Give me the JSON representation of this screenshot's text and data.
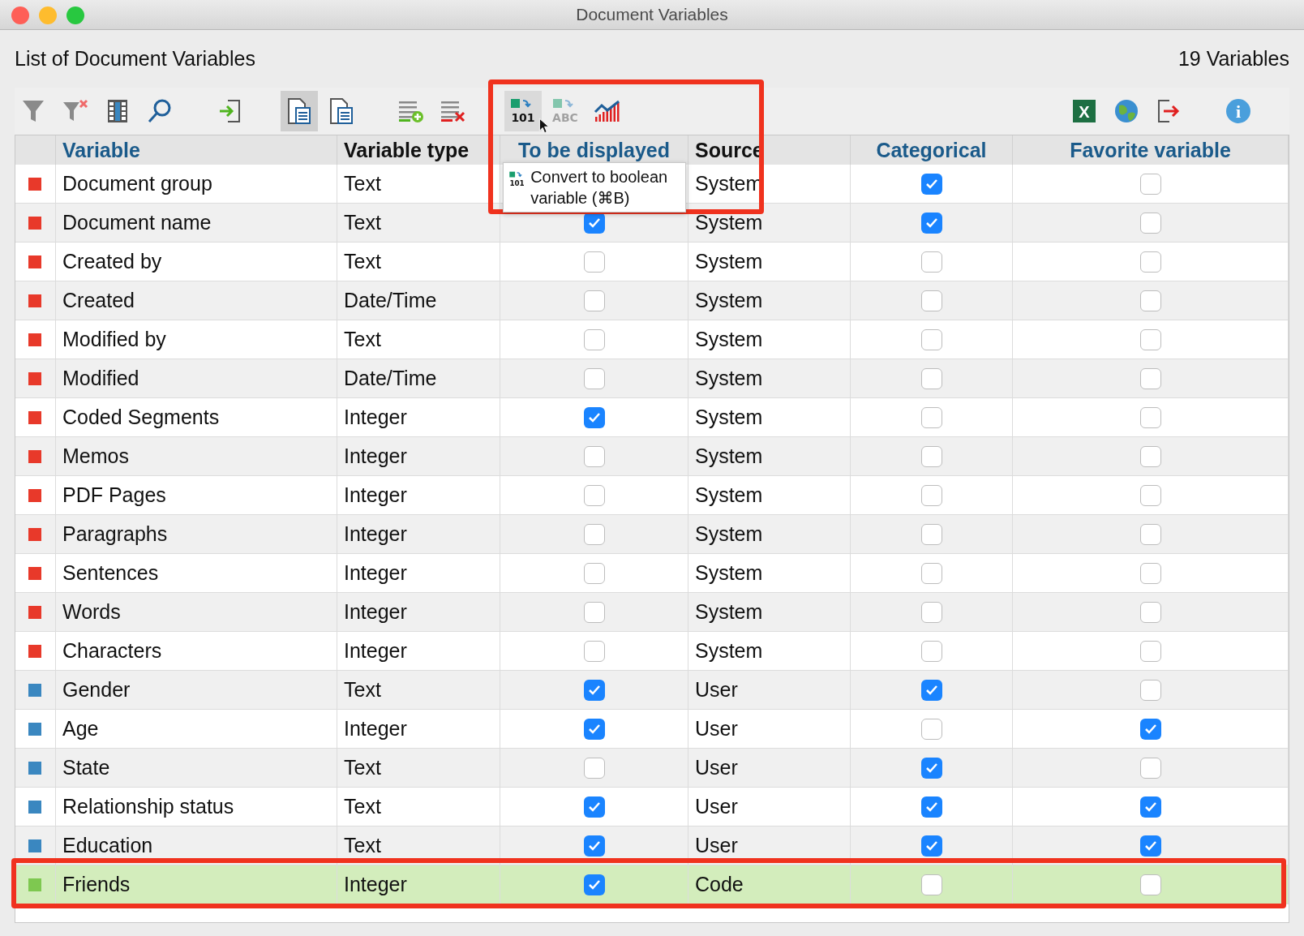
{
  "window": {
    "title": "Document Variables"
  },
  "heading": "List of Document Variables",
  "count": "19 Variables",
  "toolbar": {
    "groups": [
      [
        {
          "kind": "filter",
          "pressed": false
        },
        {
          "kind": "clear-filter",
          "pressed": false
        },
        {
          "kind": "columns",
          "pressed": false
        },
        {
          "kind": "search",
          "pressed": false
        }
      ],
      [
        {
          "kind": "import",
          "pressed": false
        }
      ],
      [
        {
          "kind": "doc-list",
          "pressed": true
        },
        {
          "kind": "doc-panel",
          "pressed": false
        }
      ],
      [
        {
          "kind": "add-row",
          "pressed": false
        },
        {
          "kind": "delete-row",
          "pressed": false
        }
      ],
      [
        {
          "kind": "to-boolean",
          "glyph": "101",
          "pressed": false,
          "hovered": true
        },
        {
          "kind": "to-text",
          "glyph": "ABC",
          "pressed": false
        },
        {
          "kind": "chart",
          "pressed": false
        }
      ]
    ],
    "right_groups": [
      [
        {
          "kind": "excel",
          "glyph": "X",
          "pressed": false
        },
        {
          "kind": "globe",
          "pressed": false
        },
        {
          "kind": "export",
          "pressed": false
        }
      ],
      [
        {
          "kind": "info",
          "glyph": "i",
          "pressed": false
        }
      ]
    ]
  },
  "tooltip": {
    "glyph": "101",
    "text": "Convert to boolean variable (⌘B)"
  },
  "table": {
    "columns": [
      {
        "label": "Variable",
        "highlighted": true
      },
      {
        "label": "Variable type",
        "highlighted": false
      },
      {
        "label": "To be displayed",
        "highlighted": true
      },
      {
        "label": "Source",
        "highlighted": false
      },
      {
        "label": "Categorical",
        "highlighted": true
      },
      {
        "label": "Favorite variable",
        "highlighted": true
      }
    ],
    "rows": [
      {
        "color": "#e8392a",
        "name": "Document group",
        "type": "Text",
        "source": "System",
        "categorical": true,
        "favorite": false,
        "selected": false
      },
      {
        "color": "#e8392a",
        "name": "Document name",
        "type": "Text",
        "displayed": true,
        "source": "System",
        "categorical": true,
        "favorite": false,
        "selected": false
      },
      {
        "color": "#e8392a",
        "name": "Created by",
        "type": "Text",
        "displayed": false,
        "source": "System",
        "categorical": false,
        "favorite": false,
        "selected": false
      },
      {
        "color": "#e8392a",
        "name": "Created",
        "type": "Date/Time",
        "displayed": false,
        "source": "System",
        "categorical": false,
        "favorite": false,
        "selected": false
      },
      {
        "color": "#e8392a",
        "name": "Modified by",
        "type": "Text",
        "displayed": false,
        "source": "System",
        "categorical": false,
        "favorite": false,
        "selected": false
      },
      {
        "color": "#e8392a",
        "name": "Modified",
        "type": "Date/Time",
        "displayed": false,
        "source": "System",
        "categorical": false,
        "favorite": false,
        "selected": false
      },
      {
        "color": "#e8392a",
        "name": "Coded Segments",
        "type": "Integer",
        "displayed": true,
        "source": "System",
        "categorical": false,
        "favorite": false,
        "selected": false
      },
      {
        "color": "#e8392a",
        "name": "Memos",
        "type": "Integer",
        "displayed": false,
        "source": "System",
        "categorical": false,
        "favorite": false,
        "selected": false
      },
      {
        "color": "#e8392a",
        "name": "PDF Pages",
        "type": "Integer",
        "displayed": false,
        "source": "System",
        "categorical": false,
        "favorite": false,
        "selected": false
      },
      {
        "color": "#e8392a",
        "name": "Paragraphs",
        "type": "Integer",
        "displayed": false,
        "source": "System",
        "categorical": false,
        "favorite": false,
        "selected": false
      },
      {
        "color": "#e8392a",
        "name": "Sentences",
        "type": "Integer",
        "displayed": false,
        "source": "System",
        "categorical": false,
        "favorite": false,
        "selected": false
      },
      {
        "color": "#e8392a",
        "name": "Words",
        "type": "Integer",
        "displayed": false,
        "source": "System",
        "categorical": false,
        "favorite": false,
        "selected": false
      },
      {
        "color": "#e8392a",
        "name": "Characters",
        "type": "Integer",
        "displayed": false,
        "source": "System",
        "categorical": false,
        "favorite": false,
        "selected": false
      },
      {
        "color": "#3a87c0",
        "name": "Gender",
        "type": "Text",
        "displayed": true,
        "source": "User",
        "categorical": true,
        "favorite": false,
        "selected": false
      },
      {
        "color": "#3a87c0",
        "name": "Age",
        "type": "Integer",
        "displayed": true,
        "source": "User",
        "categorical": false,
        "favorite": true,
        "selected": false
      },
      {
        "color": "#3a87c0",
        "name": "State",
        "type": "Text",
        "displayed": false,
        "source": "User",
        "categorical": true,
        "favorite": false,
        "selected": false
      },
      {
        "color": "#3a87c0",
        "name": "Relationship status",
        "type": "Text",
        "displayed": true,
        "source": "User",
        "categorical": true,
        "favorite": true,
        "selected": false
      },
      {
        "color": "#3a87c0",
        "name": "Education",
        "type": "Text",
        "displayed": true,
        "source": "User",
        "categorical": true,
        "favorite": true,
        "selected": false
      },
      {
        "color": "#7ec850",
        "name": "Friends",
        "type": "Integer",
        "displayed": true,
        "source": "Code",
        "categorical": false,
        "favorite": false,
        "selected": true
      }
    ]
  }
}
